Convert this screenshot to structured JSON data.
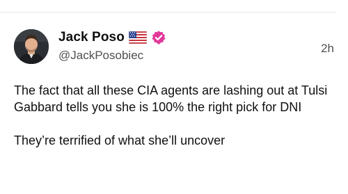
{
  "post": {
    "author": {
      "display_name": "Jack Poso",
      "handle": "@JackPosobiec",
      "badges": [
        "us-flag-icon",
        "verified-icon"
      ]
    },
    "timestamp": "2h",
    "body": [
      "The fact that all these CIA agents are lashing out at Tulsi Gabbard tells you she is 100% the right pick for DNI",
      "They’re terrified of what she’ll uncover"
    ]
  },
  "colors": {
    "verified_badge": "#e0399a",
    "text_primary": "#0f0f0f",
    "text_secondary": "#4f4f4f",
    "divider": "#e6e6e6"
  }
}
